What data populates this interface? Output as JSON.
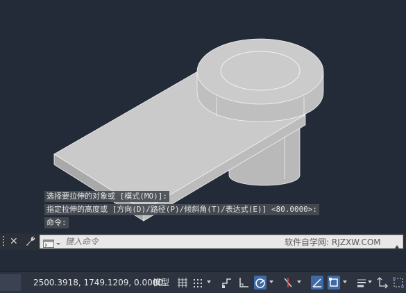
{
  "command_history": [
    "选择要拉伸的对象或 [模式(MO)]:",
    "指定拉伸的高度或 [方向(D)/路径(P)/倾斜角(T)/表达式(E)] <80.0000>:",
    "命令:"
  ],
  "command_bar": {
    "close_label": "✕",
    "input_placeholder": "键入命令",
    "watermark": "软件自学网: RJZXW.COM"
  },
  "status_bar": {
    "coordinates": "2500.3918, 1749.1209, 0.0000",
    "model_label": "模型"
  },
  "colors": {
    "viewport_bg": "#232a38",
    "solid_face": "#c9c9c9",
    "active_toggle": "#3f6aa6"
  }
}
